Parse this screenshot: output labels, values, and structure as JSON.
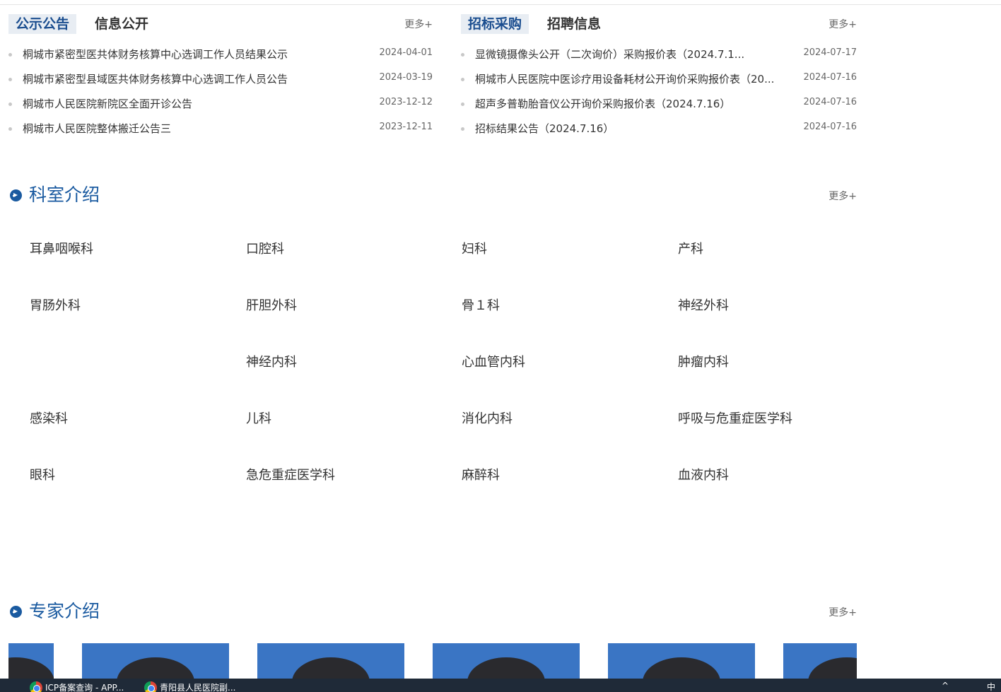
{
  "notice_panel": {
    "tab_active": "公示公告",
    "tab_inactive": "信息公开",
    "more": "更多+",
    "items": [
      {
        "title": "桐城市紧密型医共体财务核算中心选调工作人员结果公示",
        "date": "2024-04-01"
      },
      {
        "title": "桐城市紧密型县域医共体财务核算中心选调工作人员公告",
        "date": "2024-03-19"
      },
      {
        "title": "桐城市人民医院新院区全面开诊公告",
        "date": "2023-12-12"
      },
      {
        "title": "桐城市人民医院整体搬迁公告三",
        "date": "2023-12-11"
      }
    ]
  },
  "tender_panel": {
    "tab_active": "招标采购",
    "tab_inactive": "招聘信息",
    "more": "更多+",
    "items": [
      {
        "title": "显微镜摄像头公开（二次询价）采购报价表（2024.7.1...",
        "date": "2024-07-17"
      },
      {
        "title": "桐城市人民医院中医诊疗用设备耗材公开询价采购报价表（20...",
        "date": "2024-07-16"
      },
      {
        "title": "超声多普勒胎音仪公开询价采购报价表（2024.7.16）",
        "date": "2024-07-16"
      },
      {
        "title": "招标结果公告（2024.7.16）",
        "date": "2024-07-16"
      }
    ]
  },
  "departments": {
    "title": "科室介绍",
    "more": "更多+",
    "rows": [
      [
        "耳鼻咽喉科",
        "口腔科",
        "妇科",
        "产科"
      ],
      [
        "胃肠外科",
        "肝胆外科",
        "骨１科",
        "神经外科"
      ],
      [
        "",
        "神经内科",
        "心血管内科",
        "肿瘤内科"
      ],
      [
        "感染科",
        "儿科",
        "消化内科",
        "呼吸与危重症医学科"
      ],
      [
        "眼科",
        "急危重症医学科",
        "麻醉科",
        "血液内科"
      ]
    ]
  },
  "experts": {
    "title": "专家介绍",
    "more": "更多+"
  },
  "taskbar": {
    "tasks": [
      "ICP备案查询 - APP...",
      "青阳县人民医院副..."
    ],
    "tray_left": "^",
    "tray_ime": "中"
  }
}
